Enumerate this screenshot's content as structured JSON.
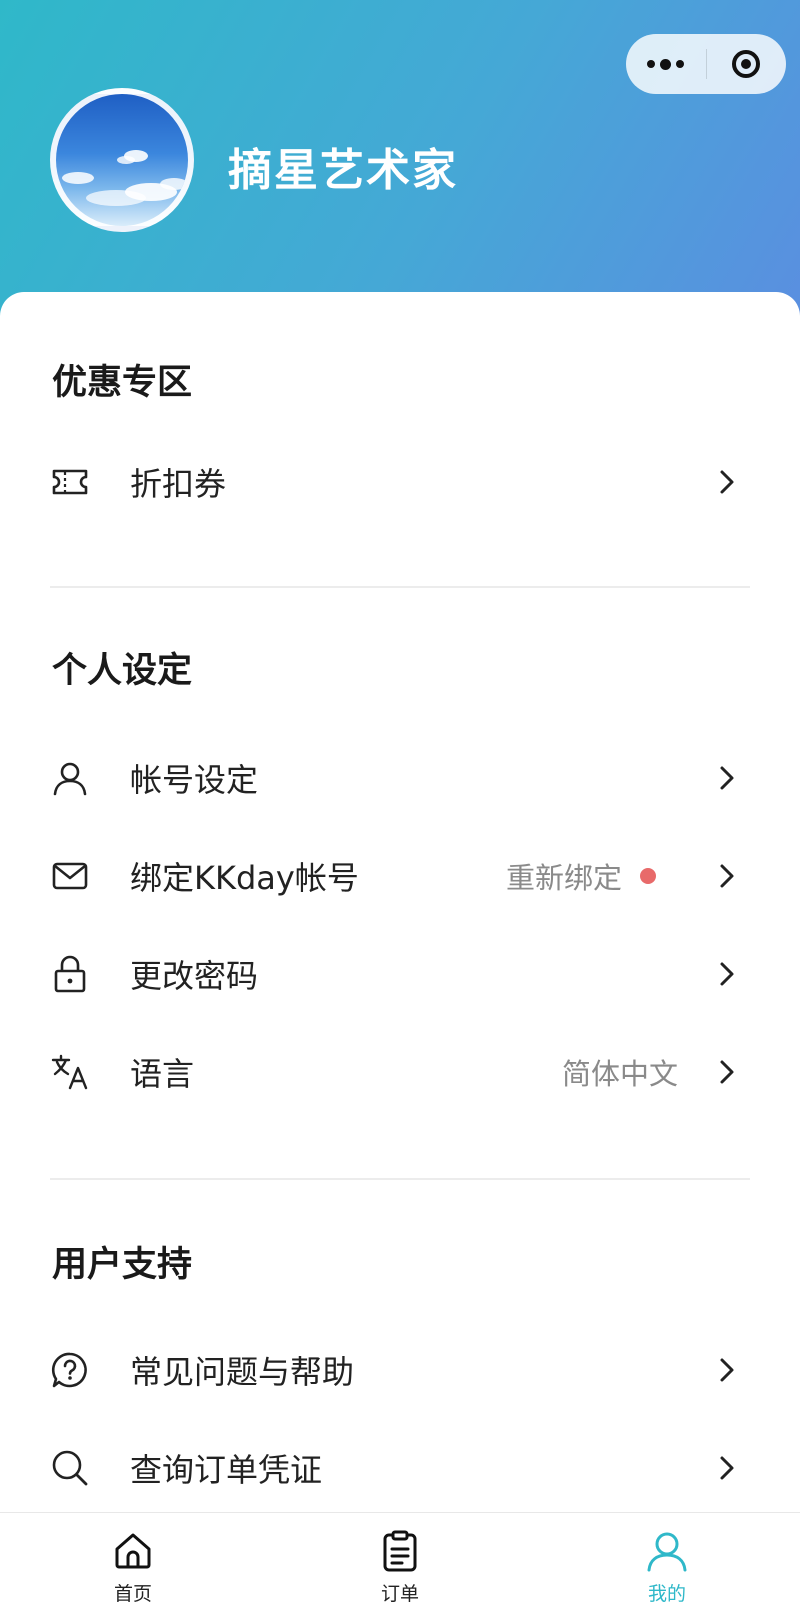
{
  "header": {
    "username": "摘星艺术家",
    "capsule": {
      "more_icon": "more-dots-icon",
      "close_icon": "target-icon"
    },
    "avatar": "sky-clouds-avatar"
  },
  "sections": {
    "promo": {
      "title": "优惠专区",
      "items": [
        {
          "label": "折扣券",
          "icon": "ticket-icon"
        }
      ]
    },
    "personal": {
      "title": "个人设定",
      "items": [
        {
          "label": "帐号设定",
          "icon": "user-icon"
        },
        {
          "label": "绑定KKday帐号",
          "icon": "mail-icon",
          "value": "重新绑定",
          "badge_color": "#e86a6a"
        },
        {
          "label": "更改密码",
          "icon": "lock-icon"
        },
        {
          "label": "语言",
          "icon": "translate-icon",
          "value": "简体中文"
        }
      ]
    },
    "support": {
      "title": "用户支持",
      "items": [
        {
          "label": "常见问题与帮助",
          "icon": "help-chat-icon"
        },
        {
          "label": "查询订单凭证",
          "icon": "search-icon"
        }
      ]
    }
  },
  "tabbar": {
    "active_color": "#2fb8c9",
    "tabs": [
      {
        "label": "首页",
        "icon": "home-icon"
      },
      {
        "label": "订单",
        "icon": "clipboard-icon"
      },
      {
        "label": "我的",
        "icon": "user-icon",
        "active": true
      }
    ]
  },
  "colors": {
    "header_gradient_start": "#2fb8c9",
    "header_gradient_end": "#5a8fe0",
    "badge": "#e86a6a",
    "accent": "#2fb8c9"
  }
}
